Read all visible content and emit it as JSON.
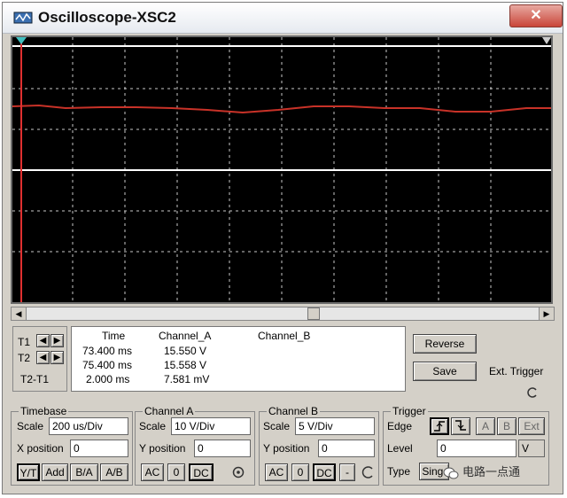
{
  "window": {
    "title": "Oscilloscope-XSC2",
    "close_label": "✕"
  },
  "cursors": {
    "t1_label": "T1",
    "t2_label": "T2",
    "diff_label": "T2-T1"
  },
  "readout": {
    "headers": [
      "Time",
      "Channel_A",
      "Channel_B"
    ],
    "rows": [
      {
        "time": "73.400 ms",
        "a": "15.550 V",
        "b": ""
      },
      {
        "time": "75.400 ms",
        "a": "15.558 V",
        "b": ""
      },
      {
        "time": "2.000 ms",
        "a": "7.581 mV",
        "b": ""
      }
    ]
  },
  "actions": {
    "reverse_label": "Reverse",
    "save_label": "Save",
    "ext_trigger_label": "Ext. Trigger"
  },
  "timebase": {
    "legend": "Timebase",
    "scale_label": "Scale",
    "scale_value": "200 us/Div",
    "xpos_label": "X position",
    "xpos_value": "0",
    "modes": [
      "Y/T",
      "Add",
      "B/A",
      "A/B"
    ]
  },
  "channel_a": {
    "legend": "Channel A",
    "scale_label": "Scale",
    "scale_value": "10  V/Div",
    "ypos_label": "Y position",
    "ypos_value": "0",
    "coupling": [
      "AC",
      "0",
      "DC"
    ]
  },
  "channel_b": {
    "legend": "Channel B",
    "scale_label": "Scale",
    "scale_value": "5  V/Div",
    "ypos_label": "Y position",
    "ypos_value": "0",
    "coupling": [
      "AC",
      "0",
      "DC",
      "-"
    ]
  },
  "trigger": {
    "legend": "Trigger",
    "edge_label": "Edge",
    "edge_buttons": [
      "A",
      "B",
      "Ext"
    ],
    "level_label": "Level",
    "level_value": "0",
    "level_unit": "V",
    "type_label": "Type",
    "type_value": "Sing."
  },
  "watermark": "电路一点通",
  "colors": {
    "screen": "#000000",
    "grid": "#c8c8c8",
    "trace_a": "#c83228",
    "trace_b": "#ffffff",
    "cursor": "#e03030"
  }
}
